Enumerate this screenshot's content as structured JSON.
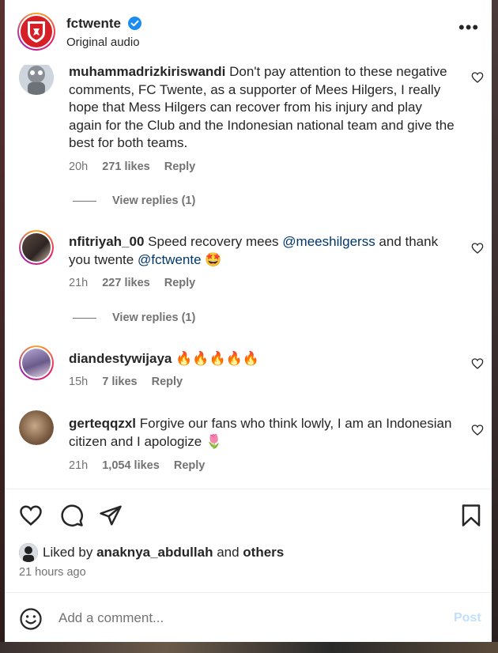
{
  "post": {
    "username": "fctwente",
    "subtitle": "Original audio",
    "more": "•••"
  },
  "comments": [
    {
      "user": "muhammadrizkiriswandi",
      "text": "Don't pay attention to these negative comments, FC Twente, as a supporter of Mees Hilgers, I really hope that Mess Hilgers can recover from his injury and play again for the Club and the Indonesian national team and give the best for both teams.",
      "time": "20h",
      "likes": "271 likes",
      "reply": "Reply",
      "view_replies": "View replies (1)"
    },
    {
      "user": "nfitriyah_00",
      "text_a": "Speed recovery mees",
      "mention_1": "@meeshilgerss",
      "text_b": "and thank you twente",
      "mention_2": "@fctwente",
      "emoji": "🤩",
      "time": "21h",
      "likes": "227 likes",
      "reply": "Reply",
      "view_replies": "View replies (1)"
    },
    {
      "user": "diandestywijaya",
      "text": "🔥🔥🔥🔥🔥",
      "time": "15h",
      "likes": "7 likes",
      "reply": "Reply"
    },
    {
      "user": "gerteqqzxl",
      "text": "Forgive our fans who think lowly, I am an Indonesian citizen and I apologize 🌷",
      "time": "21h",
      "likes": "1,054 likes",
      "reply": "Reply"
    }
  ],
  "likes_bar": {
    "prefix": "Liked by",
    "user": "anaknya_abdullah",
    "joiner": "and",
    "others": "others"
  },
  "timestamp": "21 hours ago",
  "comment_box": {
    "placeholder": "Add a comment...",
    "post": "Post"
  },
  "colors": {
    "mention": "#00376b",
    "meta": "#737373",
    "post_disabled": "#c0dffd",
    "verified": "#1b8df0"
  }
}
